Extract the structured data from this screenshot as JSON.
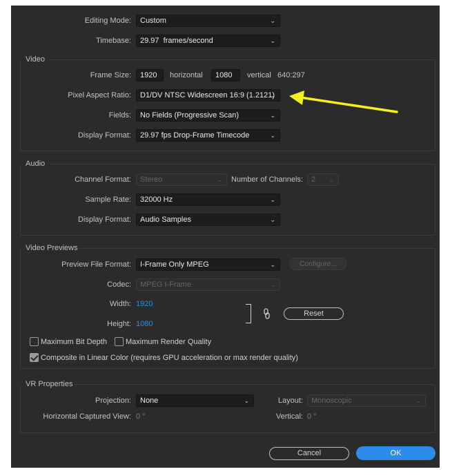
{
  "general": {
    "editing_mode": {
      "label": "Editing Mode:",
      "value": "Custom"
    },
    "timebase": {
      "label": "Timebase:",
      "value": "29.97  frames/second"
    }
  },
  "video": {
    "title": "Video",
    "frame_size": {
      "label": "Frame Size:",
      "horizontal": "1920",
      "horizontal_label": "horizontal",
      "vertical": "1080",
      "vertical_label": "vertical",
      "ratio": "640:297"
    },
    "pixel_aspect_ratio": {
      "label": "Pixel Aspect Ratio:",
      "value": "D1/DV NTSC Widescreen 16:9 (1.2121)"
    },
    "fields": {
      "label": "Fields:",
      "value": "No Fields (Progressive Scan)"
    },
    "display_format": {
      "label": "Display Format:",
      "value": "29.97 fps Drop-Frame Timecode"
    }
  },
  "audio": {
    "title": "Audio",
    "channel_format": {
      "label": "Channel Format:",
      "value": "Stereo"
    },
    "number_of_channels": {
      "label": "Number of Channels:",
      "value": "2"
    },
    "sample_rate": {
      "label": "Sample Rate:",
      "value": "32000 Hz"
    },
    "display_format": {
      "label": "Display Format:",
      "value": "Audio Samples"
    }
  },
  "video_previews": {
    "title": "Video Previews",
    "preview_file_format": {
      "label": "Preview File Format:",
      "value": "I-Frame Only MPEG"
    },
    "configure_label": "Configure...",
    "codec": {
      "label": "Codec:",
      "value": "MPEG I-Frame"
    },
    "width": {
      "label": "Width:",
      "value": "1920"
    },
    "height": {
      "label": "Height:",
      "value": "1080"
    },
    "reset_label": "Reset",
    "max_bit_depth": {
      "label": "Maximum Bit Depth",
      "checked": false
    },
    "max_render_quality": {
      "label": "Maximum Render Quality",
      "checked": false
    },
    "composite_linear": {
      "label": "Composite in Linear Color (requires GPU acceleration or max render quality)",
      "checked": true
    }
  },
  "vr": {
    "title": "VR Properties",
    "projection": {
      "label": "Projection:",
      "value": "None"
    },
    "layout": {
      "label": "Layout:",
      "value": "Monoscopic"
    },
    "horizontal_captured_view": {
      "label": "Horizontal Captured View:",
      "value": "0 °"
    },
    "vertical": {
      "label": "Vertical:",
      "value": "0 °"
    }
  },
  "footer": {
    "cancel_label": "Cancel",
    "ok_label": "OK"
  },
  "annotation": {
    "arrow_color": "#f5ef1f"
  },
  "colors": {
    "accent": "#2d8ceb",
    "dialog_bg": "#2b2b2b"
  }
}
